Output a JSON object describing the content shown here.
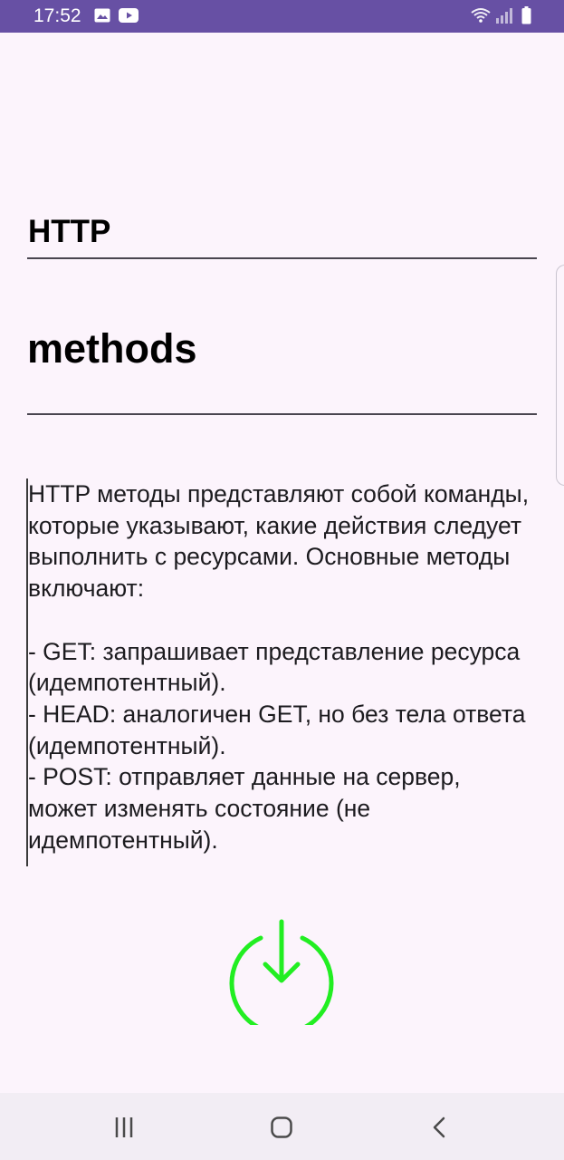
{
  "status_bar": {
    "time": "17:52",
    "icons": [
      "gallery-icon",
      "youtube-icon",
      "wifi-icon",
      "signal-icon",
      "battery-icon"
    ]
  },
  "content": {
    "title": "HTTP",
    "subtitle": "methods",
    "body": "HTTP методы представляют собой команды, которые указывают, какие действия следует выполнить с ресурсами. Основные методы включают:\n\n- GET: запрашивает представление ресурса (идемпотентный).\n- HEAD: аналогичен GET, но без тела ответа (идемпотентный).\n- POST: отправляет данные на сервер, может изменять состояние (не идемпотентный)."
  },
  "actions": {
    "download_icon": "download-icon",
    "accent_color": "#22ee22"
  },
  "navigation": {
    "icons": [
      "recent-apps-icon",
      "home-icon",
      "back-icon"
    ]
  },
  "colors": {
    "status_bar": "#6750a4",
    "background": "#fcf4fc",
    "nav_bar": "#f2edf4"
  }
}
